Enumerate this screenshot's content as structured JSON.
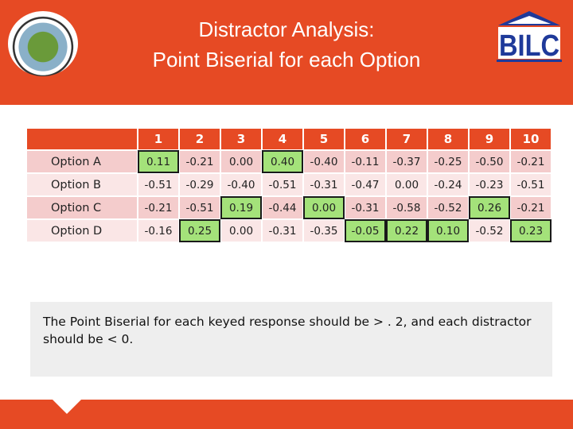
{
  "header": {
    "title_line1": "Distractor Analysis:",
    "title_line2": "Point Biserial for each Option",
    "logo_right": "BILC"
  },
  "colors": {
    "accent": "#e64a24",
    "key_cell": "#a4e27a"
  },
  "table": {
    "columns": [
      "1",
      "2",
      "3",
      "4",
      "5",
      "6",
      "7",
      "8",
      "9",
      "10"
    ],
    "rows": [
      {
        "label": "Option A",
        "values": [
          "0.11",
          "-0.21",
          "0.00",
          "0.40",
          "-0.40",
          "-0.11",
          "-0.37",
          "-0.25",
          "-0.50",
          "-0.21"
        ],
        "keyed": [
          0,
          3
        ]
      },
      {
        "label": "Option B",
        "values": [
          "-0.51",
          "-0.29",
          "-0.40",
          "-0.51",
          "-0.31",
          "-0.47",
          "0.00",
          "-0.24",
          "-0.23",
          "-0.51"
        ],
        "keyed": []
      },
      {
        "label": "Option C",
        "values": [
          "-0.21",
          "-0.51",
          "0.19",
          "-0.44",
          "0.00",
          "-0.31",
          "-0.58",
          "-0.52",
          "0.26",
          "-0.21"
        ],
        "keyed": [
          2,
          4,
          8
        ]
      },
      {
        "label": "Option D",
        "values": [
          "-0.16",
          "0.25",
          "0.00",
          "-0.31",
          "-0.35",
          "-0.05",
          "0.22",
          "0.10",
          "-0.52",
          "0.23"
        ],
        "keyed": [
          1,
          5,
          6,
          7,
          9
        ]
      }
    ]
  },
  "note": "The Point Biserial for each keyed response should be > . 2, and each distractor should be < 0."
}
